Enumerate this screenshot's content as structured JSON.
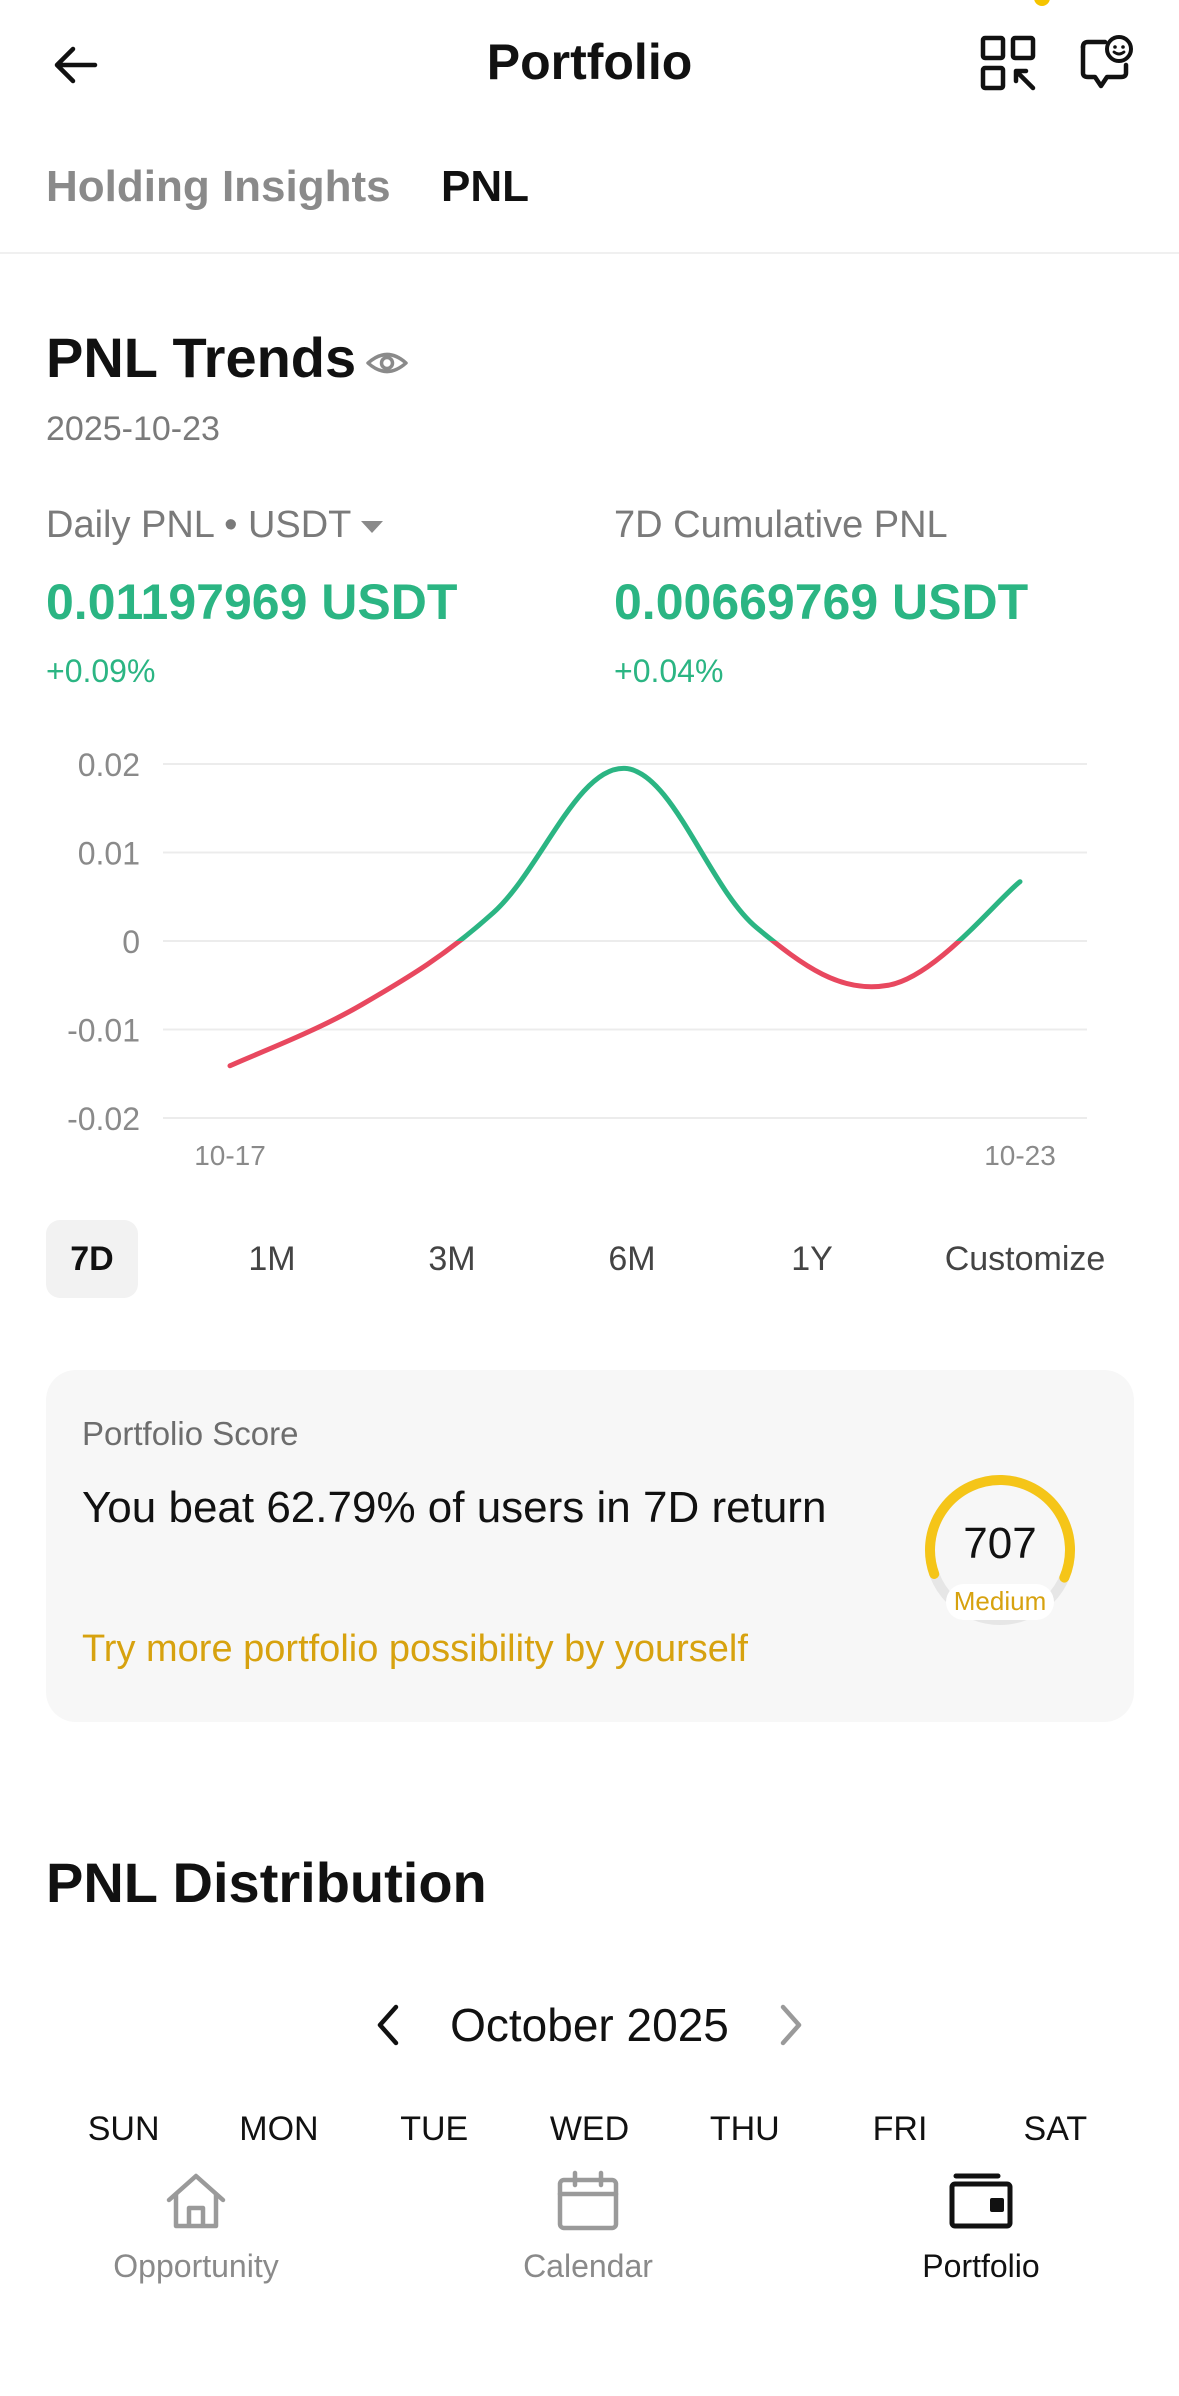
{
  "header": {
    "title": "Portfolio",
    "back_icon": "arrow-left-icon",
    "qr_icon": "qr-scan-icon",
    "support_icon": "chat-support-icon"
  },
  "tabs": [
    {
      "label": "Holding Insights",
      "active": false
    },
    {
      "label": "PNL",
      "active": true
    }
  ],
  "pnl_trends": {
    "title": "PNL Trends",
    "date": "2025-10-23",
    "daily": {
      "label": "Daily PNL • USDT",
      "value": "0.01197969 USDT",
      "change": "+0.09%"
    },
    "cumulative": {
      "label": "7D Cumulative PNL",
      "value": "0.00669769 USDT",
      "change": "+0.04%"
    }
  },
  "chart_data": {
    "type": "line",
    "title": "",
    "xlabel": "",
    "ylabel": "",
    "x": [
      "10-17",
      "10-18",
      "10-19",
      "10-20",
      "10-21",
      "10-22",
      "10-23"
    ],
    "y": [
      -0.0141,
      -0.0072,
      0.0032,
      0.0195,
      0.0015,
      -0.005,
      0.0067
    ],
    "x_tick_labels": [
      "10-17",
      "10-23"
    ],
    "y_ticks": [
      0.02,
      0.01,
      0,
      -0.01,
      -0.02
    ],
    "y_tick_labels": [
      "0.02",
      "0.01",
      "0",
      "-0.01",
      "-0.02"
    ],
    "ylim": [
      -0.02,
      0.02
    ],
    "grid": true,
    "positive_color": "#2bb583",
    "negative_color": "#e8485f"
  },
  "range_options": [
    "7D",
    "1M",
    "3M",
    "6M",
    "1Y",
    "Customize"
  ],
  "range_selected": "7D",
  "score": {
    "label": "Portfolio Score",
    "text": "You beat 62.79% of users in 7D return",
    "link": "Try more portfolio possibility by yourself",
    "value": "707",
    "level": "Medium",
    "gauge_fraction": 0.62,
    "accent": "#f5c518"
  },
  "distribution": {
    "title": "PNL Distribution",
    "month": "October 2025",
    "weekdays": [
      "SUN",
      "MON",
      "TUE",
      "WED",
      "THU",
      "FRI",
      "SAT"
    ]
  },
  "bottom_nav": [
    {
      "label": "Opportunity",
      "icon": "home-icon",
      "active": false
    },
    {
      "label": "Calendar",
      "icon": "calendar-icon",
      "active": false
    },
    {
      "label": "Portfolio",
      "icon": "wallet-icon",
      "active": true
    }
  ],
  "colors": {
    "green": "#2bb583",
    "red": "#e8485f",
    "gold": "#d7a20f"
  }
}
